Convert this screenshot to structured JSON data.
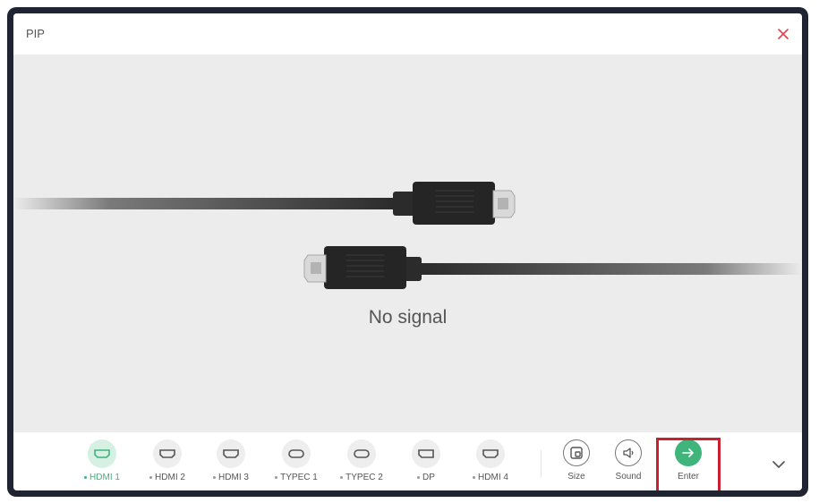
{
  "window": {
    "title": "PIP"
  },
  "preview": {
    "status_text": "No signal"
  },
  "sources": [
    {
      "label": "HDMI 1",
      "active": true
    },
    {
      "label": "HDMI 2",
      "active": false
    },
    {
      "label": "HDMI 3",
      "active": false
    },
    {
      "label": "TYPEC 1",
      "active": false
    },
    {
      "label": "TYPEC 2",
      "active": false
    },
    {
      "label": "DP",
      "active": false
    },
    {
      "label": "HDMI 4",
      "active": false
    }
  ],
  "actions": {
    "size_label": "Size",
    "sound_label": "Sound",
    "enter_label": "Enter"
  },
  "icons": {
    "close": "close-icon",
    "hdmi": "hdmi-port-icon",
    "typec": "typec-port-icon",
    "dp": "displayport-icon",
    "size": "pip-size-icon",
    "sound": "speaker-icon",
    "enter": "arrow-right-icon",
    "expand": "chevron-down-icon"
  },
  "colors": {
    "accent": "#3fb47b",
    "highlight": "#c8202f",
    "close": "#e0414f"
  }
}
